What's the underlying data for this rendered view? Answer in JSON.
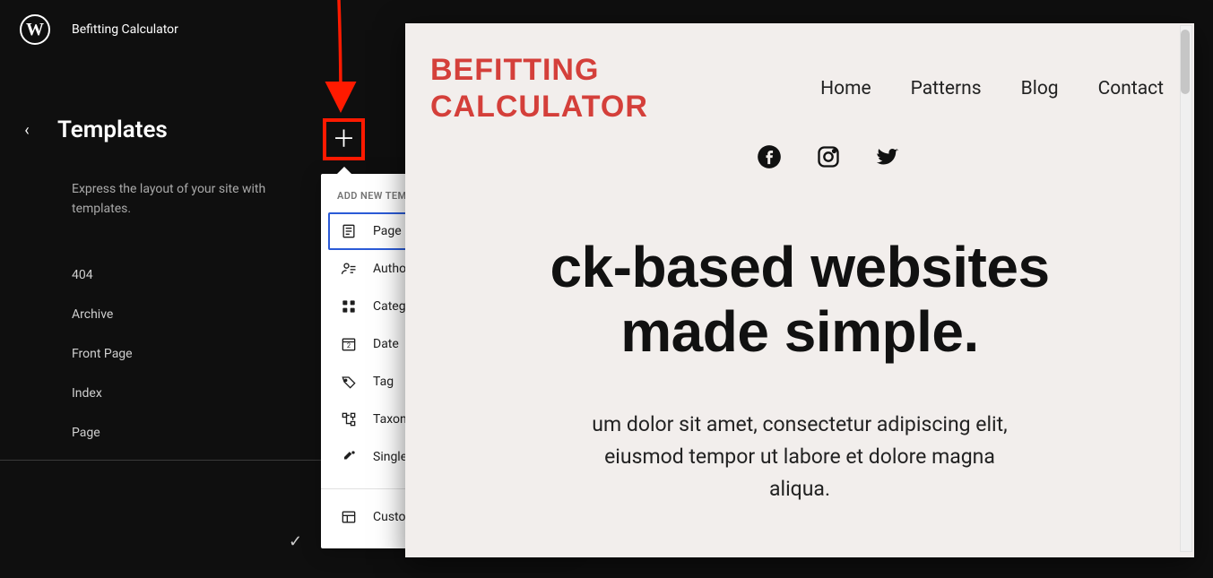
{
  "app": {
    "site_name": "Befitting Calculator"
  },
  "sidebar": {
    "title": "Templates",
    "description": "Express the layout of your site with templates.",
    "items": [
      {
        "label": "404"
      },
      {
        "label": "Archive"
      },
      {
        "label": "Front Page"
      },
      {
        "label": "Index"
      },
      {
        "label": "Page"
      }
    ]
  },
  "popover": {
    "heading": "ADD NEW TEMPLATE",
    "items": [
      {
        "label": "Page",
        "icon": "page-icon",
        "selected": true
      },
      {
        "label": "Author",
        "icon": "author-icon"
      },
      {
        "label": "Category",
        "icon": "category-icon"
      },
      {
        "label": "Date",
        "icon": "date-icon"
      },
      {
        "label": "Tag",
        "icon": "tag-icon"
      },
      {
        "label": "Taxonomy",
        "icon": "taxonomy-icon"
      },
      {
        "label": "Single item: Post",
        "icon": "post-icon"
      }
    ],
    "footer": {
      "label": "Custom template",
      "icon": "custom-template-icon"
    }
  },
  "preview": {
    "site_title_line1": "BEFITTING",
    "site_title_line2": "CALCULATOR",
    "nav": [
      {
        "label": "Home"
      },
      {
        "label": "Patterns"
      },
      {
        "label": "Blog"
      },
      {
        "label": "Contact"
      }
    ],
    "hero_title_line1": "ck-based websites",
    "hero_title_line2": "made simple.",
    "hero_p_line1": "um dolor sit amet, consectetur adipiscing elit,",
    "hero_p_line2": "eiusmod tempor ut labore et dolore magna",
    "hero_p_line3": "aliqua."
  }
}
